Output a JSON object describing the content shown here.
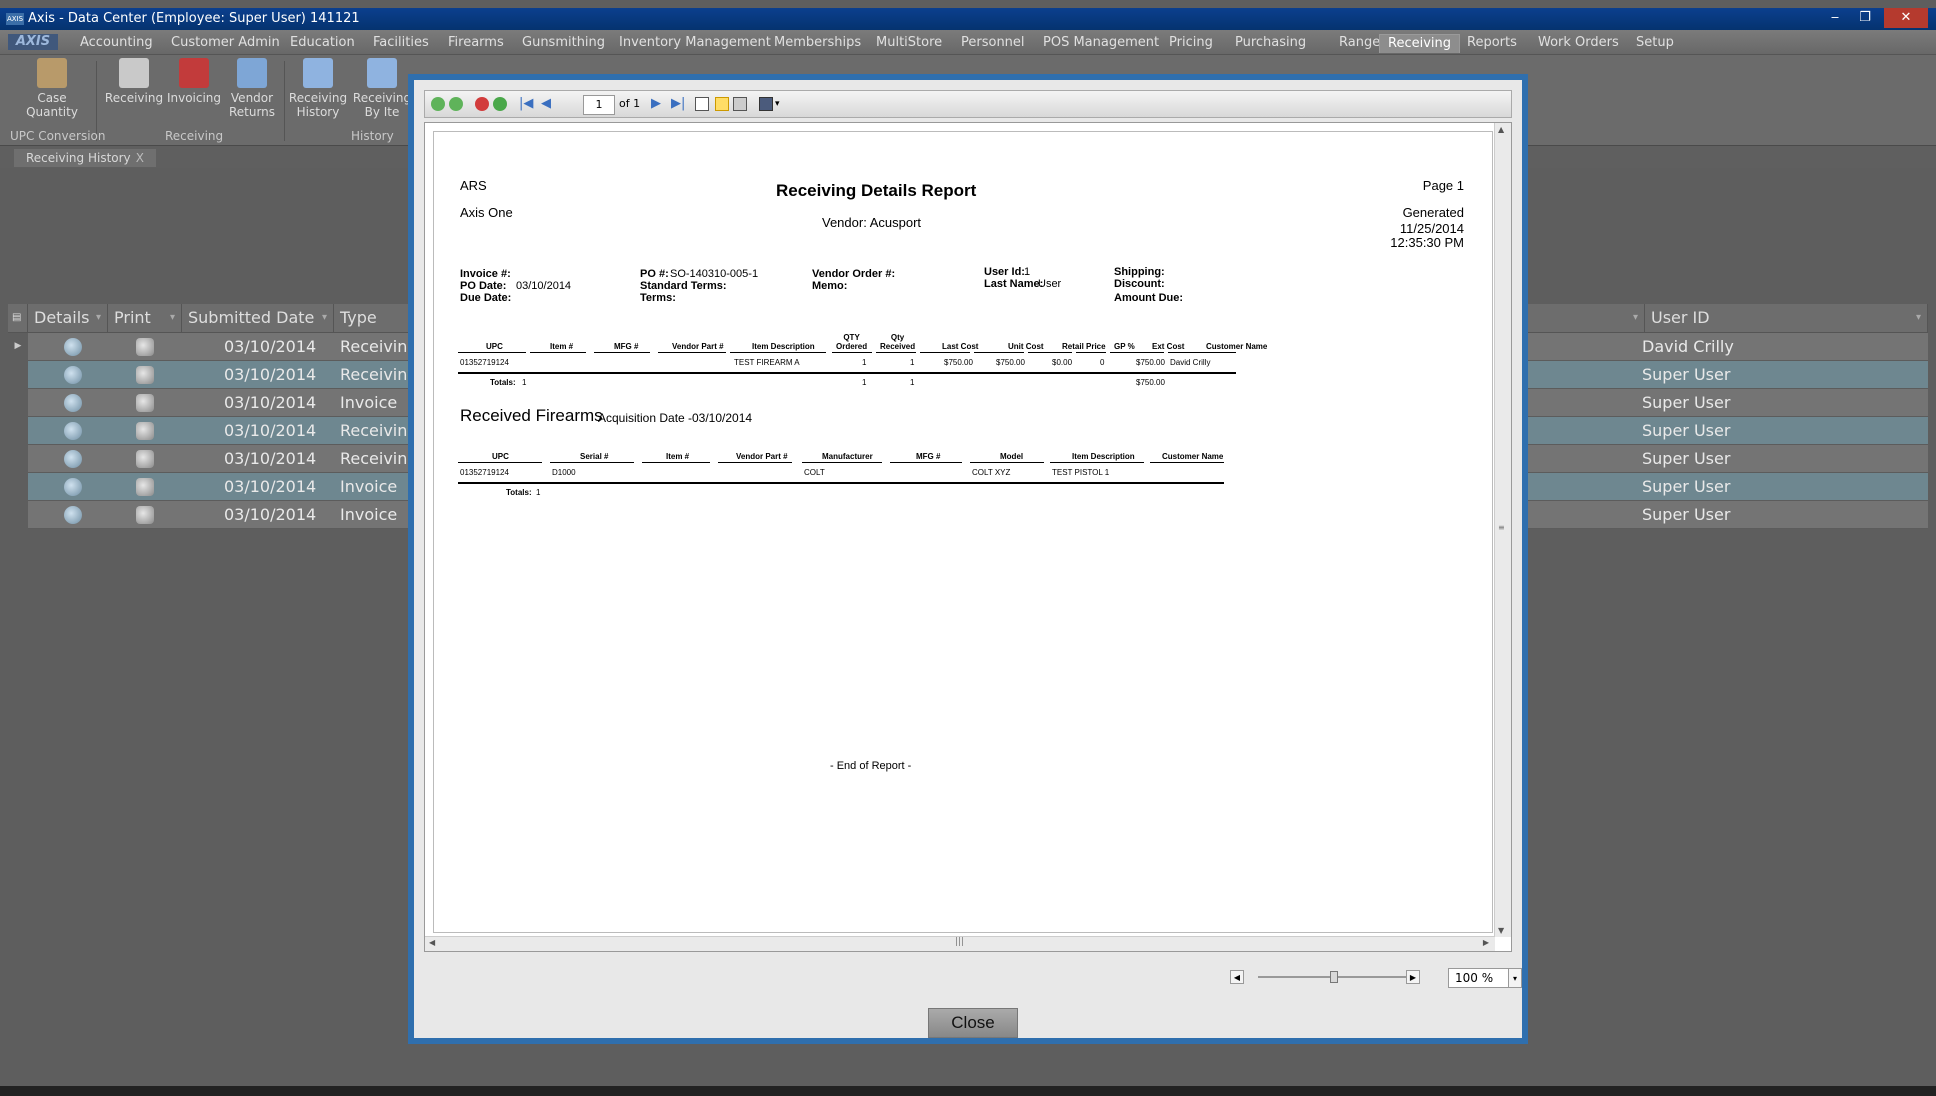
{
  "window": {
    "title": "Axis - Data Center  (Employee: Super User) 141121",
    "logo": "AXIS",
    "minimize": "‒",
    "restore": "❐",
    "close": "✕"
  },
  "menu": [
    "Accounting",
    "Customer Admin",
    "Education",
    "Facilities",
    "Firearms",
    "Gunsmithing",
    "Inventory Management",
    "Memberships",
    "MultiStore",
    "Personnel",
    "POS Management",
    "Pricing",
    "Purchasing",
    "Range",
    "Receiving",
    "Reports",
    "Work Orders",
    "Setup"
  ],
  "menu_active": "Receiving",
  "ribbon": {
    "buttons": [
      {
        "l1": "Case",
        "l2": "Quantity",
        "color": "#b89a6a"
      },
      {
        "l1": "Receiving",
        "l2": "",
        "color": "#c9c9c9"
      },
      {
        "l1": "Invoicing",
        "l2": "",
        "color": "#c23b3b"
      },
      {
        "l1": "Vendor",
        "l2": "Returns",
        "color": "#7ea6d6"
      },
      {
        "l1": "Receiving",
        "l2": "History",
        "color": "#8fb3e0"
      },
      {
        "l1": "Receiving",
        "l2": "By Ite",
        "color": "#8fb3e0"
      }
    ],
    "groups": [
      "UPC Conversion",
      "Receiving",
      "History"
    ]
  },
  "doc_tab": {
    "label": "Receiving History",
    "close": "X"
  },
  "grid": {
    "headers": [
      "Details",
      "Print",
      "Submitted Date",
      "Type",
      "User ID"
    ],
    "rows": [
      {
        "date": "03/10/2014",
        "type": "Receiving",
        "user": "David Crilly"
      },
      {
        "date": "03/10/2014",
        "type": "Receiving",
        "user": "Super User"
      },
      {
        "date": "03/10/2014",
        "type": "Invoice",
        "user": "Super User"
      },
      {
        "date": "03/10/2014",
        "type": "Receiving",
        "user": "Super User"
      },
      {
        "date": "03/10/2014",
        "type": "Receiving",
        "user": "Super User"
      },
      {
        "date": "03/10/2014",
        "type": "Invoice",
        "user": "Super User"
      },
      {
        "date": "03/10/2014",
        "type": "Invoice",
        "user": "Super User"
      }
    ]
  },
  "viewer": {
    "page_value": "1",
    "page_of": "of 1",
    "zoom": "100 %",
    "close_label": "Close"
  },
  "report": {
    "company_short": "ARS",
    "company_name": "Axis One",
    "title": "Receiving Details Report",
    "vendor": "Vendor: Acusport",
    "page": "Page 1",
    "generated_label": "Generated",
    "generated_date": "11/25/2014",
    "generated_time": "12:35:30 PM",
    "fields": {
      "invoice_label": "Invoice #:",
      "po_date_label": "PO Date:",
      "po_date": "03/10/2014",
      "due_date_label": "Due Date:",
      "po_label": "PO #:",
      "po": "SO-140310-005-1",
      "std_terms_label": "Standard Terms:",
      "terms_label": "Terms:",
      "vendor_order_label": "Vendor Order #:",
      "memo_label": "Memo:",
      "user_id_label": "User Id:",
      "user_id": "1",
      "last_name_label": "Last Name:",
      "last_name": "User",
      "shipping_label": "Shipping:",
      "discount_label": "Discount:",
      "amount_due_label": "Amount Due:"
    },
    "items": {
      "headers": [
        "UPC",
        "Item #",
        "MFG #",
        "Vendor Part #",
        "Item Description",
        "QTY\nOrdered",
        "Qty\nReceived",
        "Last Cost",
        "Unit Cost",
        "Retail Price",
        "GP %",
        "Ext Cost",
        "Customer Name"
      ],
      "row": [
        "01352719124",
        "",
        "",
        "",
        "TEST FIREARM A",
        "1",
        "1",
        "$750.00",
        "$750.00",
        "$0.00",
        "0",
        "$750.00",
        "David Crilly"
      ],
      "totals_label": "Totals:",
      "totals_count": "1",
      "totals_ordered": "1",
      "totals_received": "1",
      "totals_ext": "$750.00"
    },
    "firearms": {
      "section_title": "Received Firearms",
      "acq_label": "Acquisition Date -",
      "acq_date": "03/10/2014",
      "headers": [
        "UPC",
        "Serial #",
        "Item #",
        "Vendor Part #",
        "Manufacturer",
        "MFG #",
        "Model",
        "Item Description",
        "Customer Name"
      ],
      "row": [
        "01352719124",
        "D1000",
        "",
        "",
        "COLT",
        "",
        "COLT XYZ",
        "TEST PISTOL 1",
        ""
      ],
      "totals_label": "Totals:",
      "totals_count": "1"
    },
    "end": "- End of Report -"
  }
}
